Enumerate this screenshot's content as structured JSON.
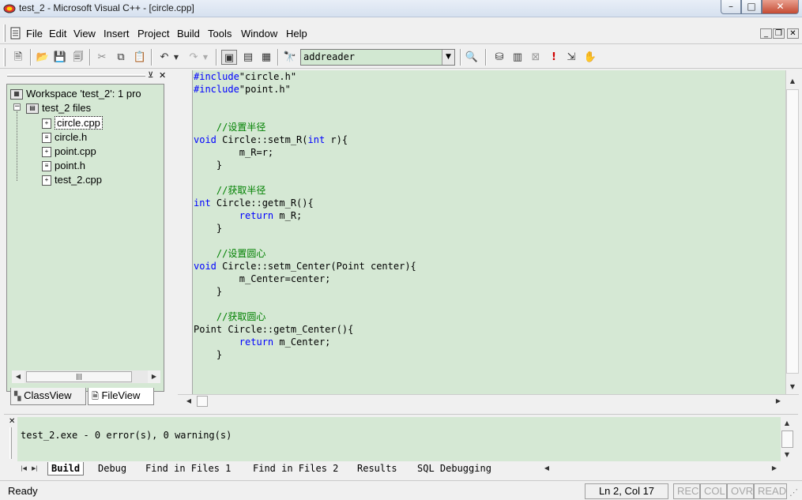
{
  "window": {
    "title": "test_2 - Microsoft Visual C++ - [circle.cpp]",
    "min": "–",
    "max": "□",
    "close": "✕"
  },
  "menu": {
    "items": [
      "File",
      "Edit",
      "View",
      "Insert",
      "Project",
      "Build",
      "Tools",
      "Window",
      "Help"
    ]
  },
  "toolbar": {
    "combo_value": "addreader"
  },
  "workspace": {
    "root": "Workspace 'test_2': 1 pro",
    "project": "test_2 files",
    "files": [
      "circle.cpp",
      "circle.h",
      "point.cpp",
      "point.h",
      "test_2.cpp"
    ],
    "selected": "circle.cpp",
    "tabs": [
      "ClassView",
      "FileView"
    ]
  },
  "editor": {
    "lines": [
      "#include\"circle.h\"",
      "#include\"point.h\"",
      "",
      "",
      "    //设置半径",
      "void Circle::setm_R(int r){",
      "        m_R=r;",
      "    }",
      "",
      "    //获取半径",
      "int Circle::getm_R(){",
      "        return m_R;",
      "    }",
      "",
      "    //设置圆心",
      "void Circle::setm_Center(Point center){",
      "        m_Center=center;",
      "    }",
      "",
      "    //获取圆心",
      "Point Circle::getm_Center(){",
      "        return m_Center;",
      "    }"
    ]
  },
  "output": {
    "text": "test_2.exe - 0 error(s), 0 warning(s)",
    "tabs": [
      "Build",
      "Debug",
      "Find in Files 1",
      "Find in Files 2",
      "Results",
      "SQL Debugging"
    ]
  },
  "status": {
    "left": "Ready",
    "position": "Ln 2, Col 17",
    "rec": "REC",
    "col": "COL",
    "ovr": "OVR",
    "read": "READ"
  }
}
